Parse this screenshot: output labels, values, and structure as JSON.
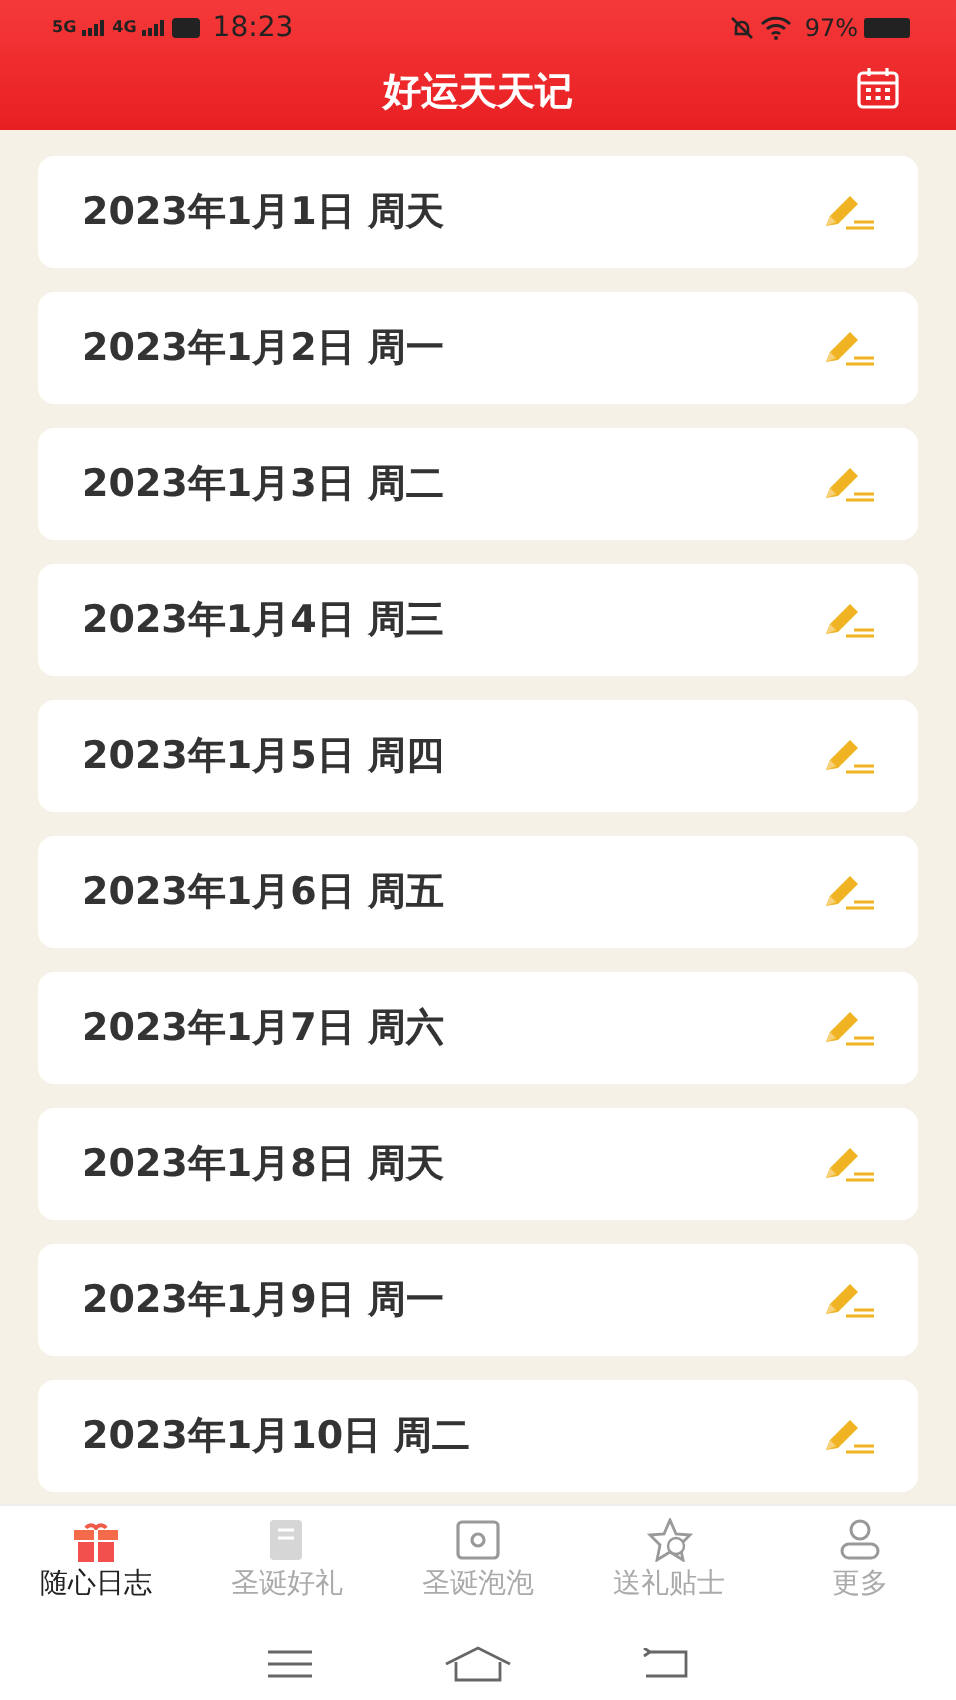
{
  "status_bar": {
    "network_1": "5G",
    "network_2": "4G",
    "time": "18:23",
    "battery": "97%"
  },
  "header": {
    "title": "好运天天记"
  },
  "entries": [
    {
      "date": "2023年1月1日 周天"
    },
    {
      "date": "2023年1月2日 周一"
    },
    {
      "date": "2023年1月3日 周二"
    },
    {
      "date": "2023年1月4日 周三"
    },
    {
      "date": "2023年1月5日 周四"
    },
    {
      "date": "2023年1月6日 周五"
    },
    {
      "date": "2023年1月7日 周六"
    },
    {
      "date": "2023年1月8日 周天"
    },
    {
      "date": "2023年1月9日 周一"
    },
    {
      "date": "2023年1月10日 周二"
    }
  ],
  "tabs": [
    {
      "label": "随心日志",
      "selected": true,
      "kind": "gift"
    },
    {
      "label": "圣诞好礼",
      "selected": false,
      "kind": "book"
    },
    {
      "label": "圣诞泡泡",
      "selected": false,
      "kind": "frame"
    },
    {
      "label": "送礼贴士",
      "selected": false,
      "kind": "star"
    },
    {
      "label": "更多",
      "selected": false,
      "kind": "person"
    }
  ]
}
